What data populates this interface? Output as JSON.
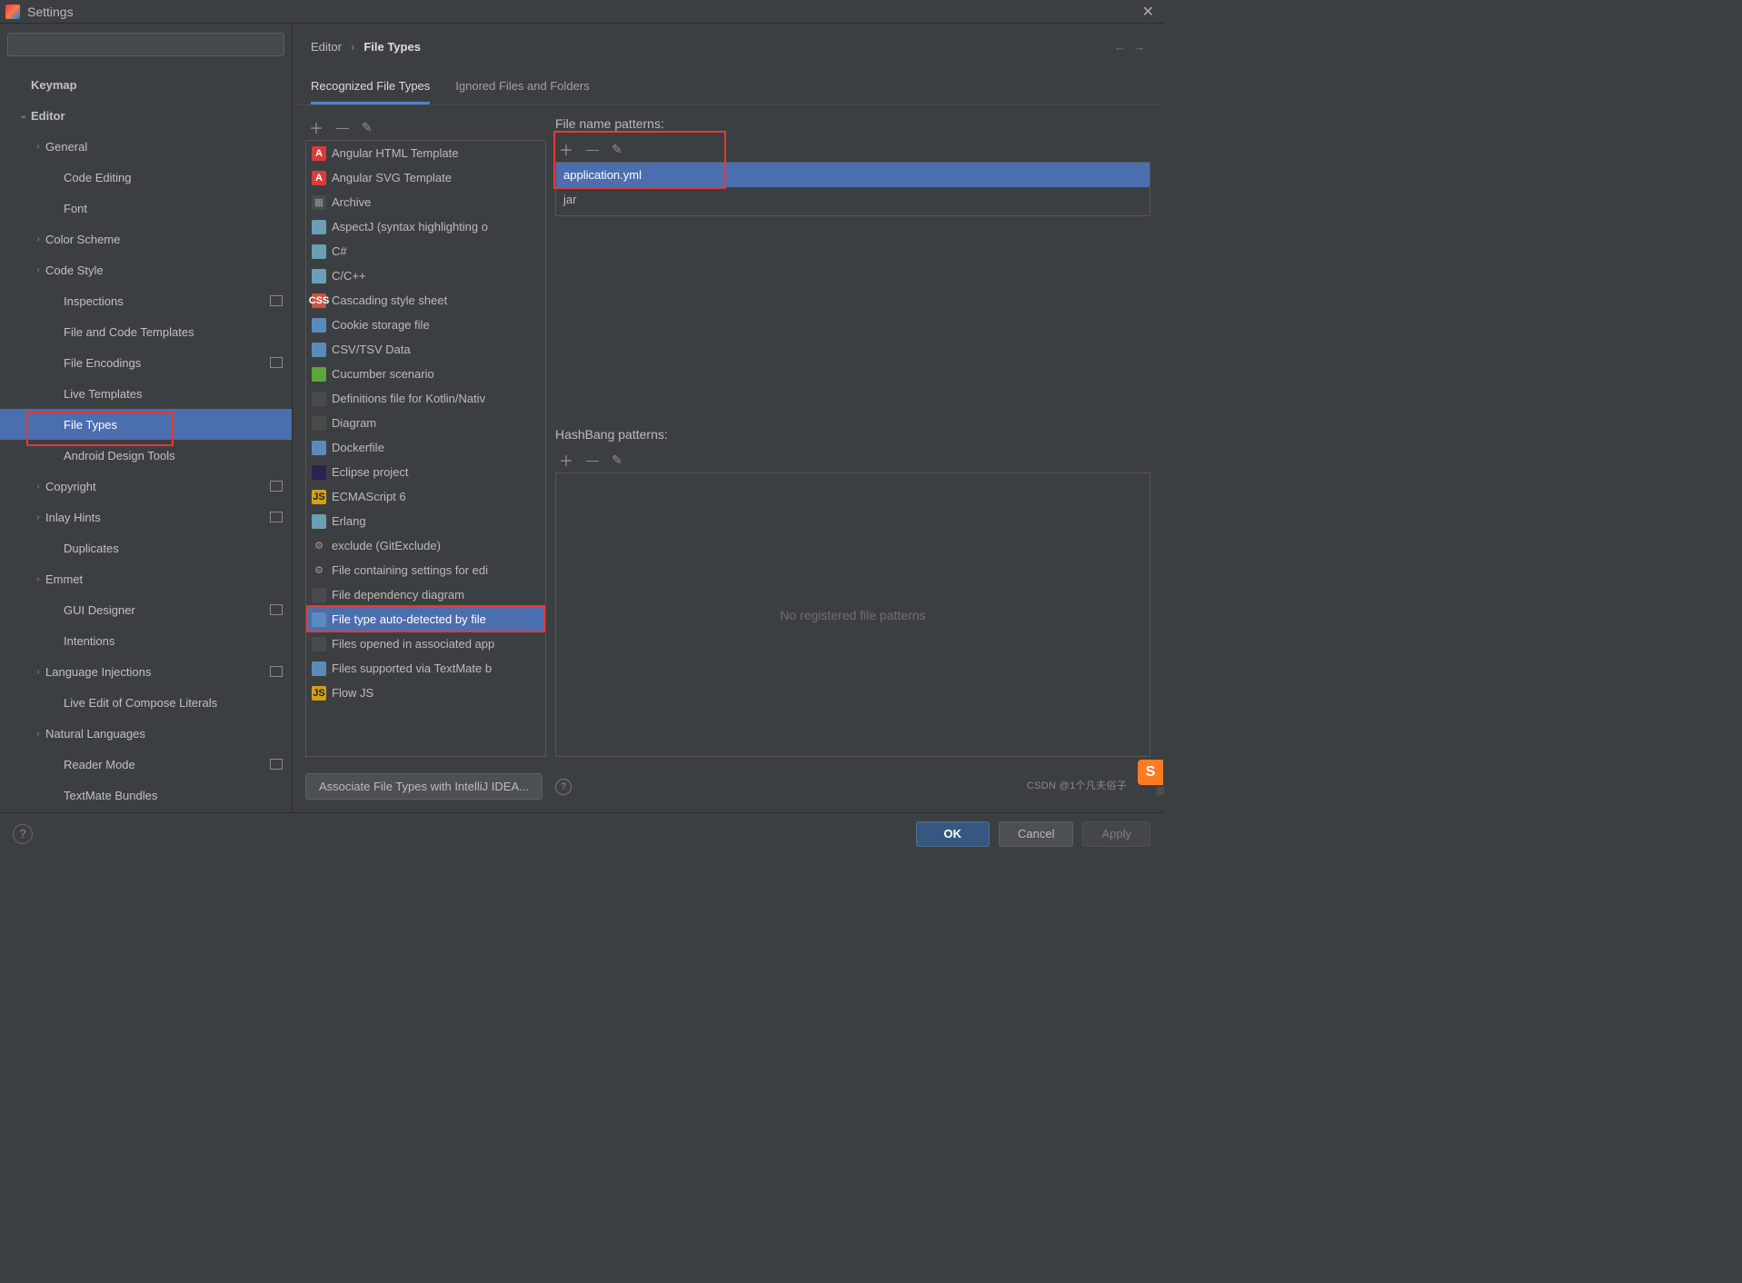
{
  "window": {
    "title": "Settings"
  },
  "search": {
    "placeholder": ""
  },
  "nav": [
    {
      "label": "Keymap",
      "level": 0,
      "chev": "",
      "badge": false
    },
    {
      "label": "Editor",
      "level": 0,
      "chev": "⌄",
      "badge": false
    },
    {
      "label": "General",
      "level": 1,
      "chev": "›",
      "badge": false
    },
    {
      "label": "Code Editing",
      "level": 2,
      "chev": "",
      "badge": false
    },
    {
      "label": "Font",
      "level": 2,
      "chev": "",
      "badge": false
    },
    {
      "label": "Color Scheme",
      "level": 1,
      "chev": "›",
      "badge": false
    },
    {
      "label": "Code Style",
      "level": 1,
      "chev": "›",
      "badge": false
    },
    {
      "label": "Inspections",
      "level": 2,
      "chev": "",
      "badge": true
    },
    {
      "label": "File and Code Templates",
      "level": 2,
      "chev": "",
      "badge": false
    },
    {
      "label": "File Encodings",
      "level": 2,
      "chev": "",
      "badge": true
    },
    {
      "label": "Live Templates",
      "level": 2,
      "chev": "",
      "badge": false
    },
    {
      "label": "File Types",
      "level": 2,
      "chev": "",
      "badge": false,
      "selected": true
    },
    {
      "label": "Android Design Tools",
      "level": 2,
      "chev": "",
      "badge": false
    },
    {
      "label": "Copyright",
      "level": 1,
      "chev": "›",
      "badge": true
    },
    {
      "label": "Inlay Hints",
      "level": 1,
      "chev": "›",
      "badge": true
    },
    {
      "label": "Duplicates",
      "level": 2,
      "chev": "",
      "badge": false
    },
    {
      "label": "Emmet",
      "level": 1,
      "chev": "›",
      "badge": false
    },
    {
      "label": "GUI Designer",
      "level": 2,
      "chev": "",
      "badge": true
    },
    {
      "label": "Intentions",
      "level": 2,
      "chev": "",
      "badge": false
    },
    {
      "label": "Language Injections",
      "level": 1,
      "chev": "›",
      "badge": true
    },
    {
      "label": "Live Edit of Compose Literals",
      "level": 2,
      "chev": "",
      "badge": false
    },
    {
      "label": "Natural Languages",
      "level": 1,
      "chev": "›",
      "badge": false
    },
    {
      "label": "Reader Mode",
      "level": 2,
      "chev": "",
      "badge": true
    },
    {
      "label": "TextMate Bundles",
      "level": 2,
      "chev": "",
      "badge": false
    }
  ],
  "breadcrumb": {
    "a": "Editor",
    "b": "File Types"
  },
  "tabs": {
    "a": "Recognized File Types",
    "b": "Ignored Files and Folders"
  },
  "filetypes": [
    {
      "label": "Angular HTML Template",
      "icon": "ic-a",
      "txt": "A"
    },
    {
      "label": "Angular SVG Template",
      "icon": "ic-a",
      "txt": "A"
    },
    {
      "label": "Archive",
      "icon": "ic-g",
      "txt": "▦"
    },
    {
      "label": "AspectJ (syntax highlighting o",
      "icon": "ic-f",
      "txt": ""
    },
    {
      "label": "C#",
      "icon": "ic-f",
      "txt": ""
    },
    {
      "label": "C/C++",
      "icon": "ic-f",
      "txt": ""
    },
    {
      "label": "Cascading style sheet",
      "icon": "ic-css",
      "txt": "CSS"
    },
    {
      "label": "Cookie storage file",
      "icon": "ic-doc",
      "txt": ""
    },
    {
      "label": "CSV/TSV Data",
      "icon": "ic-doc",
      "txt": ""
    },
    {
      "label": "Cucumber scenario",
      "icon": "ic-cu",
      "txt": ""
    },
    {
      "label": "Definitions file for Kotlin/Nativ",
      "icon": "ic-g",
      "txt": ""
    },
    {
      "label": "Diagram",
      "icon": "ic-g",
      "txt": ""
    },
    {
      "label": "Dockerfile",
      "icon": "ic-doc",
      "txt": ""
    },
    {
      "label": "Eclipse project",
      "icon": "ic-ec",
      "txt": ""
    },
    {
      "label": "ECMAScript 6",
      "icon": "ic-js",
      "txt": "JS"
    },
    {
      "label": "Erlang",
      "icon": "ic-f",
      "txt": ""
    },
    {
      "label": "exclude (GitExclude)",
      "icon": "ic-cog",
      "txt": "⚙"
    },
    {
      "label": "File containing settings for edi",
      "icon": "ic-cog",
      "txt": "⚙"
    },
    {
      "label": "File dependency diagram",
      "icon": "ic-g",
      "txt": ""
    },
    {
      "label": "File type auto-detected by file",
      "icon": "ic-doc",
      "txt": "",
      "selected": true
    },
    {
      "label": "Files opened in associated app",
      "icon": "ic-g",
      "txt": ""
    },
    {
      "label": "Files supported via TextMate b",
      "icon": "ic-doc",
      "txt": ""
    },
    {
      "label": "Flow JS",
      "icon": "ic-js",
      "txt": "JS"
    }
  ],
  "patterns": {
    "heading": "File name patterns:",
    "items": [
      {
        "label": "application.yml",
        "selected": true
      },
      {
        "label": "jar"
      }
    ],
    "hash_heading": "HashBang patterns:",
    "empty": "No registered file patterns"
  },
  "assoc": {
    "btn": "Associate File Types with IntelliJ IDEA..."
  },
  "footer": {
    "ok": "OK",
    "cancel": "Cancel",
    "apply": "Apply"
  },
  "watermark": "CSDN @1个凡夫俗子"
}
